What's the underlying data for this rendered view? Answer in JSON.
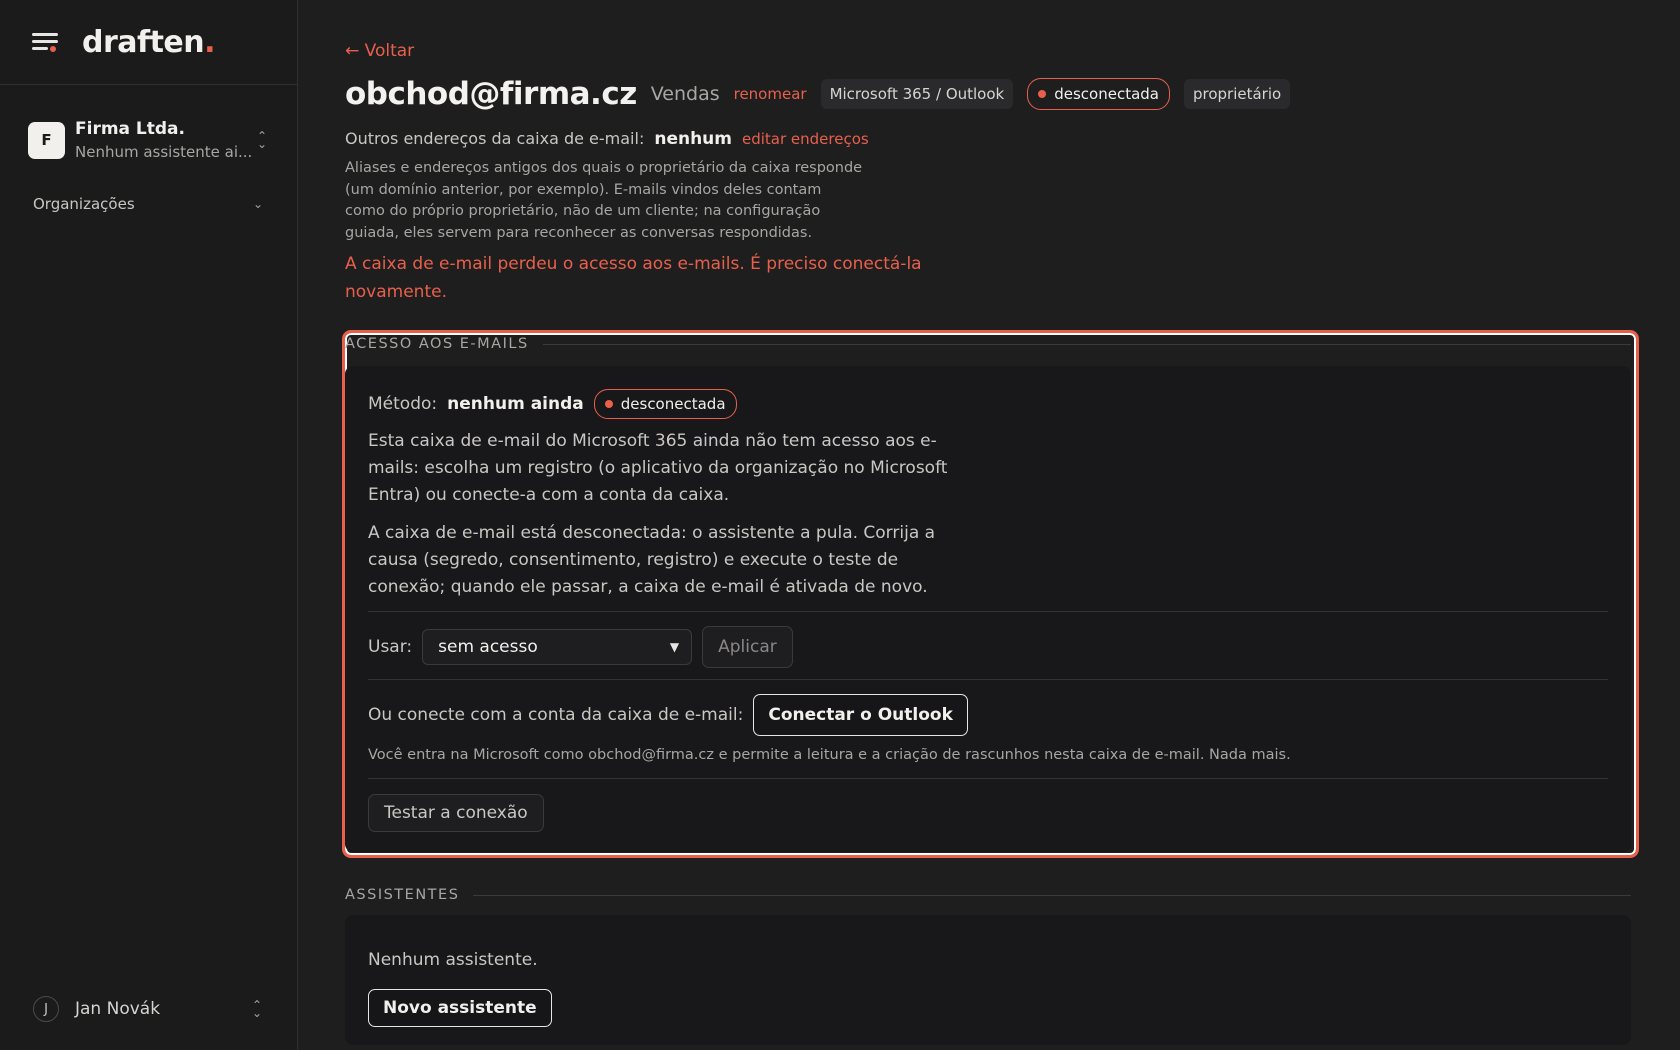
{
  "sidebar": {
    "brand": "draften",
    "brand_dot": ".",
    "org": {
      "avatar": "F",
      "name": "Firma Ltda.",
      "subtitle": "Nenhum assistente ai..."
    },
    "nav_organizations": "Organizações",
    "user": {
      "avatar": "J",
      "name": "Jan Novák"
    }
  },
  "header": {
    "back": "← Voltar",
    "title": "obchod@firma.cz",
    "subtitle": "Vendas",
    "rename": "renomear",
    "provider_tag": "Microsoft 365 / Outlook",
    "status": "desconectada",
    "role_tag": "proprietário"
  },
  "aliases": {
    "label": "Outros endereços da caixa de e-mail:",
    "value": "nenhum",
    "edit": "editar endereços",
    "help": "Aliases e endereços antigos dos quais o proprietário da caixa responde (um domínio anterior, por exemplo). E-mails vindos deles contam como do próprio proprietário, não de um cliente; na configuração guiada, eles servem para reconhecer as conversas respondidas."
  },
  "warning": "A caixa de e-mail perdeu o acesso aos e-mails. É preciso conectá-la novamente.",
  "access": {
    "section_title": "ACESSO AOS E-MAILS",
    "method_label": "Método:",
    "method_value": "nenhum ainda",
    "status": "desconectada",
    "para1": "Esta caixa de e-mail do Microsoft 365 ainda não tem acesso aos e-mails: escolha um registro (o aplicativo da organização no Microsoft Entra) ou conecte-a com a conta da caixa.",
    "para2": "A caixa de e-mail está desconectada: o assistente a pula. Corrija a causa (segredo, consentimento, registro) e execute o teste de conexão; quando ele passar, a caixa de e-mail é ativada de novo.",
    "use_label": "Usar:",
    "use_selected": "sem acesso",
    "apply": "Aplicar",
    "connect_label": "Ou conecte com a conta da caixa de e-mail:",
    "connect_button": "Conectar o Outlook",
    "connect_help": "Você entra na Microsoft como obchod@firma.cz e permite a leitura e a criação de rascunhos nesta caixa de e-mail. Nada mais.",
    "test_button": "Testar a conexão"
  },
  "assistants": {
    "section_title": "ASSISTENTES",
    "empty": "Nenhum assistente.",
    "new_button": "Novo assistente"
  },
  "colors": {
    "accent": "#e8604c",
    "background": "#1e1e1f",
    "card": "#18181a"
  }
}
